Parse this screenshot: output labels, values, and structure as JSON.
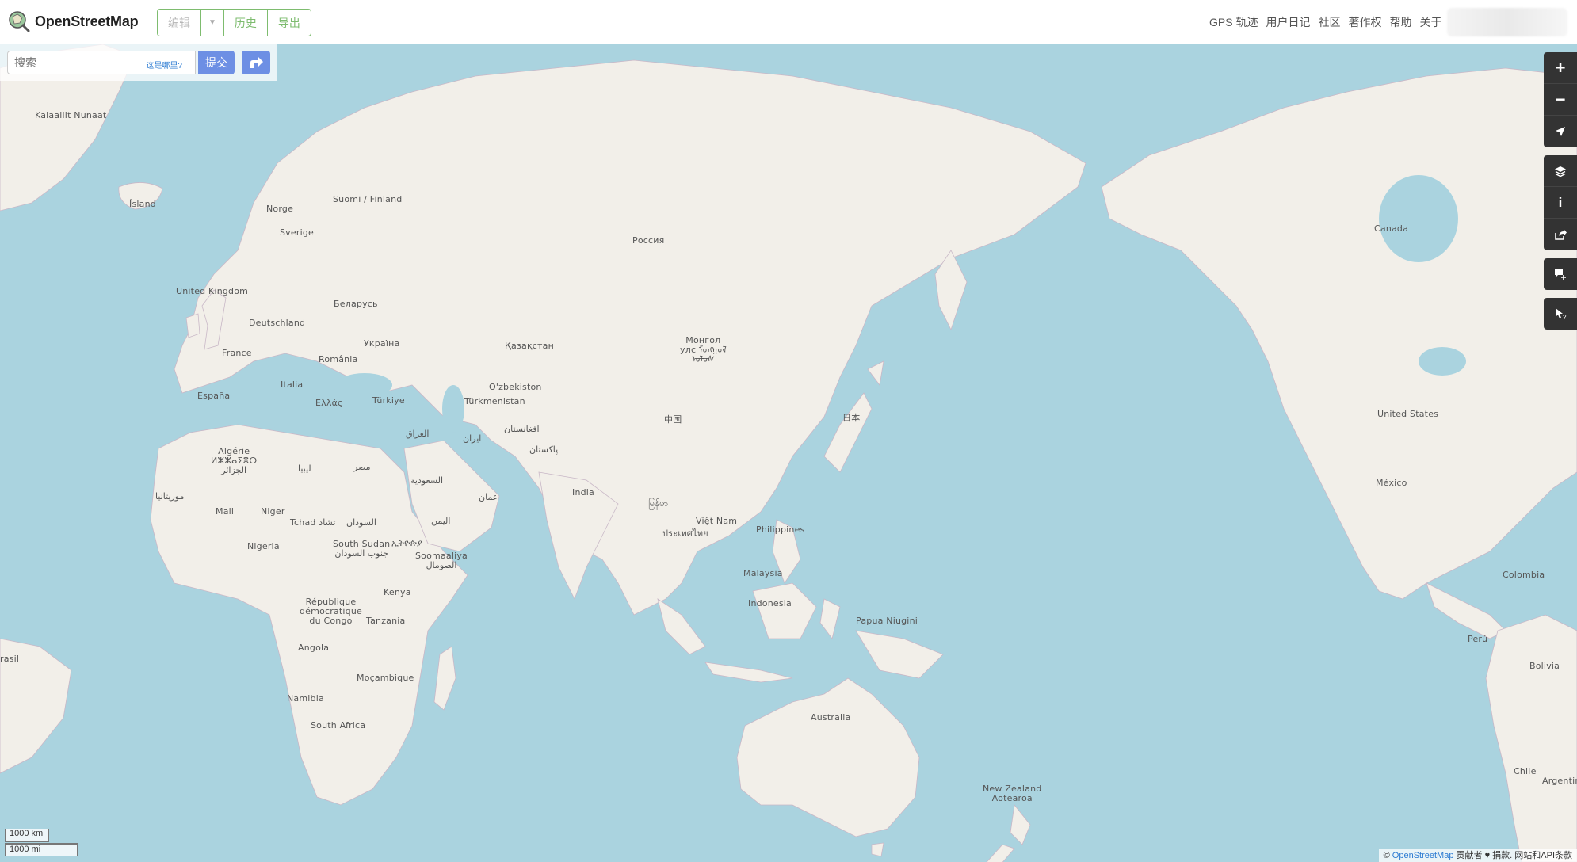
{
  "header": {
    "logo_text": "OpenStreetMap",
    "buttons": {
      "edit": "编辑",
      "history": "历史",
      "export": "导出"
    },
    "nav": [
      "GPS 轨迹",
      "用户日记",
      "社区",
      "著作权",
      "帮助",
      "关于"
    ]
  },
  "search": {
    "placeholder": "搜索",
    "where_link": "这是哪里?",
    "submit_label": "提交"
  },
  "map_labels": {
    "kalaallit": "Kalaallit\nNunaat",
    "island": "Ísland",
    "norge": "Norge",
    "suomi": "Suomi /\nFinland",
    "sverige": "Sverige",
    "uk": "United Kingdom",
    "belarus": "Беларусь",
    "deutschland": "Deutschland",
    "ukraina": "Україна",
    "france": "France",
    "romania": "România",
    "italia": "Italia",
    "espana": "España",
    "ellas": "Ελλάς",
    "turkiye": "Türkiye",
    "rossiya": "Россия",
    "kazakhstan": "Қазақстан",
    "mongol": "Монгол\nулс ᠮᠣᠩᠭᠣᠯ\nᠤᠯᠤᠰ",
    "uzbekistan": "O'zbekiston",
    "turkmenistan": "Türkmenistan",
    "iraq": "العراق",
    "iran": "ایران",
    "afghanistan": "افغانستان",
    "pakistan": "پاکستان",
    "china": "中国",
    "japan": "日本",
    "algerie": "Algérie\nⵍⵣⵣⴰⵢⴻⵔ\nالجزائر",
    "libya": "ليبيا",
    "misr": "مصر",
    "saudi": "السعودية",
    "oman": "عمان",
    "india": "India",
    "myanmar": "မြန်မာ",
    "mauritania": "موريتانيا",
    "mali": "Mali",
    "niger": "Niger",
    "tchad": "Tchad تشاد",
    "sudan": "السودان",
    "yemen": "اليمن",
    "vietnam": "Việt Nam",
    "thailand": "ประเทศไทย",
    "philippines": "Philippines",
    "nigeria": "Nigeria",
    "south_sudan": "South Sudan\nجنوب السودان",
    "ethiopia": "ኢትዮጵያ",
    "somalia": "Soomaaliya\nالصومال",
    "malaysia": "Malaysia",
    "indonesia": "Indonesia",
    "papua": "Papua Niugini",
    "kenya": "Kenya",
    "drc": "République\ndémocratique\ndu Congo",
    "tanzania": "Tanzania",
    "angola": "Angola",
    "mocambique": "Moçambique",
    "namibia": "Namibia",
    "south_africa": "South Africa",
    "australia": "Australia",
    "nz": "New Zealand\nAotearoa",
    "canada": "Canada",
    "usa": "United States",
    "mexico": "México",
    "colombia": "Colombia",
    "peru": "Perú",
    "bolivia": "Bolivia",
    "chile": "Chile",
    "argentina": "Argentin",
    "brasil": "rasil"
  },
  "scale": {
    "metric": "1000 km",
    "imperial": "1000 mi"
  },
  "attribution": {
    "prefix": "©",
    "link": "OpenStreetMap",
    "rest": " 贡献者 ♥ 捐款. 网站和API条款"
  },
  "controls": [
    "zoom-in-icon",
    "zoom-out-icon",
    "locate-icon",
    "layers-icon",
    "info-icon",
    "share-icon",
    "note-icon",
    "query-icon"
  ],
  "colors": {
    "water": "#aad3df",
    "land": "#f2efe9",
    "accent": "#7ebc6f",
    "button_blue": "#6d8fe4",
    "control_dark": "#333333"
  }
}
